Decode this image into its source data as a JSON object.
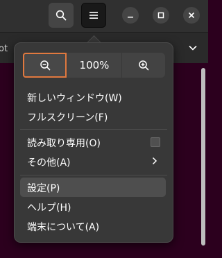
{
  "header": {
    "search_icon": "search-icon",
    "menu_icon": "hamburger-menu-icon",
    "window_controls": [
      "minimize-icon",
      "maximize-icon",
      "close-icon"
    ]
  },
  "tab": {
    "title_fragment": "ot"
  },
  "zoom": {
    "level": "100%"
  },
  "menu": {
    "new_window": "新しいウィンドウ(W)",
    "fullscreen": "フルスクリーン(F)",
    "read_only": "読み取り専用(O)",
    "other": "その他(A)",
    "settings": "設定(P)",
    "help": "ヘルプ(H)",
    "about": "端末について(A)"
  },
  "colors": {
    "focus_accent": "#e1793f",
    "terminal_background": "#2c001e",
    "popover_background": "#383838"
  }
}
